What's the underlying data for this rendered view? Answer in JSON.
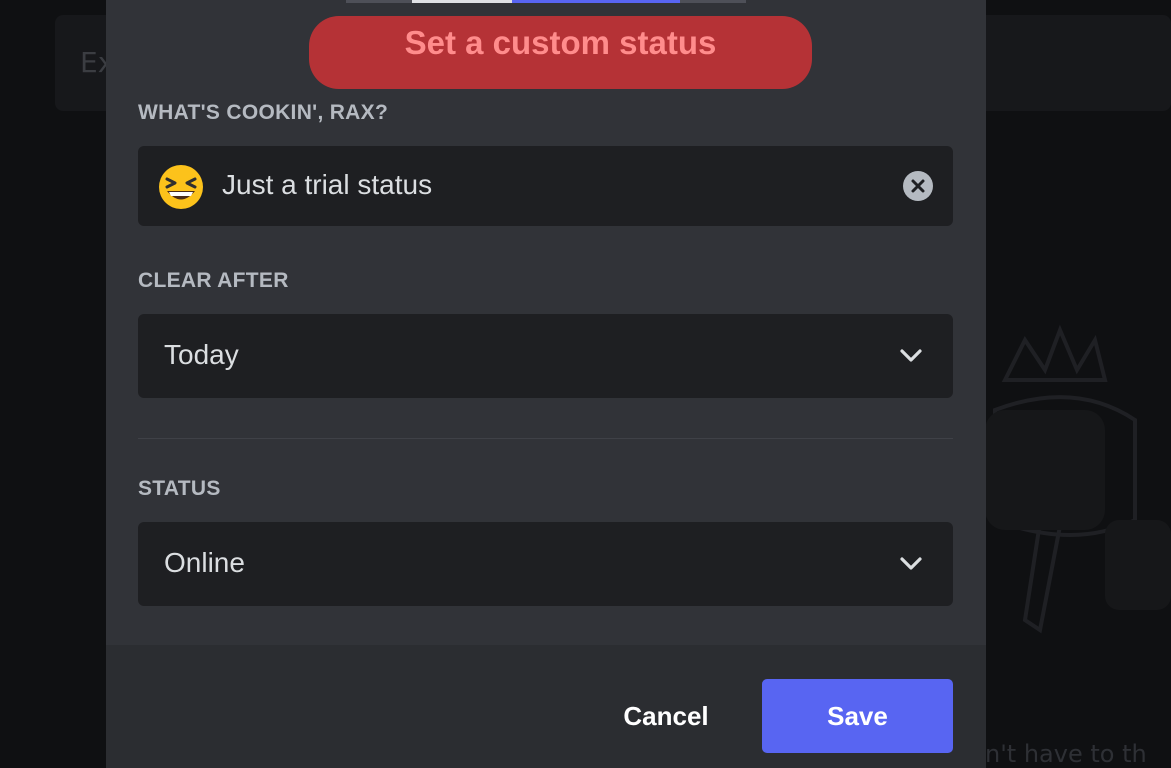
{
  "background": {
    "top_text": "Ex",
    "bottom_text": "n't have to th"
  },
  "modal": {
    "title": "Set a custom status",
    "status_section": {
      "label": "WHAT'S COOKIN', RAX?",
      "emoji_icon": "grinning-squinting-face-icon",
      "value": "Just a trial status"
    },
    "clear_after": {
      "label": "CLEAR AFTER",
      "selected": "Today"
    },
    "status": {
      "label": "STATUS",
      "selected": "Online"
    },
    "footer": {
      "cancel_label": "Cancel",
      "save_label": "Save"
    }
  },
  "colors": {
    "accent": "#5865f2",
    "title_banner": "#b53236",
    "title_text": "#ff8c8c",
    "modal_bg": "#313338",
    "field_bg": "#1e1f22"
  }
}
